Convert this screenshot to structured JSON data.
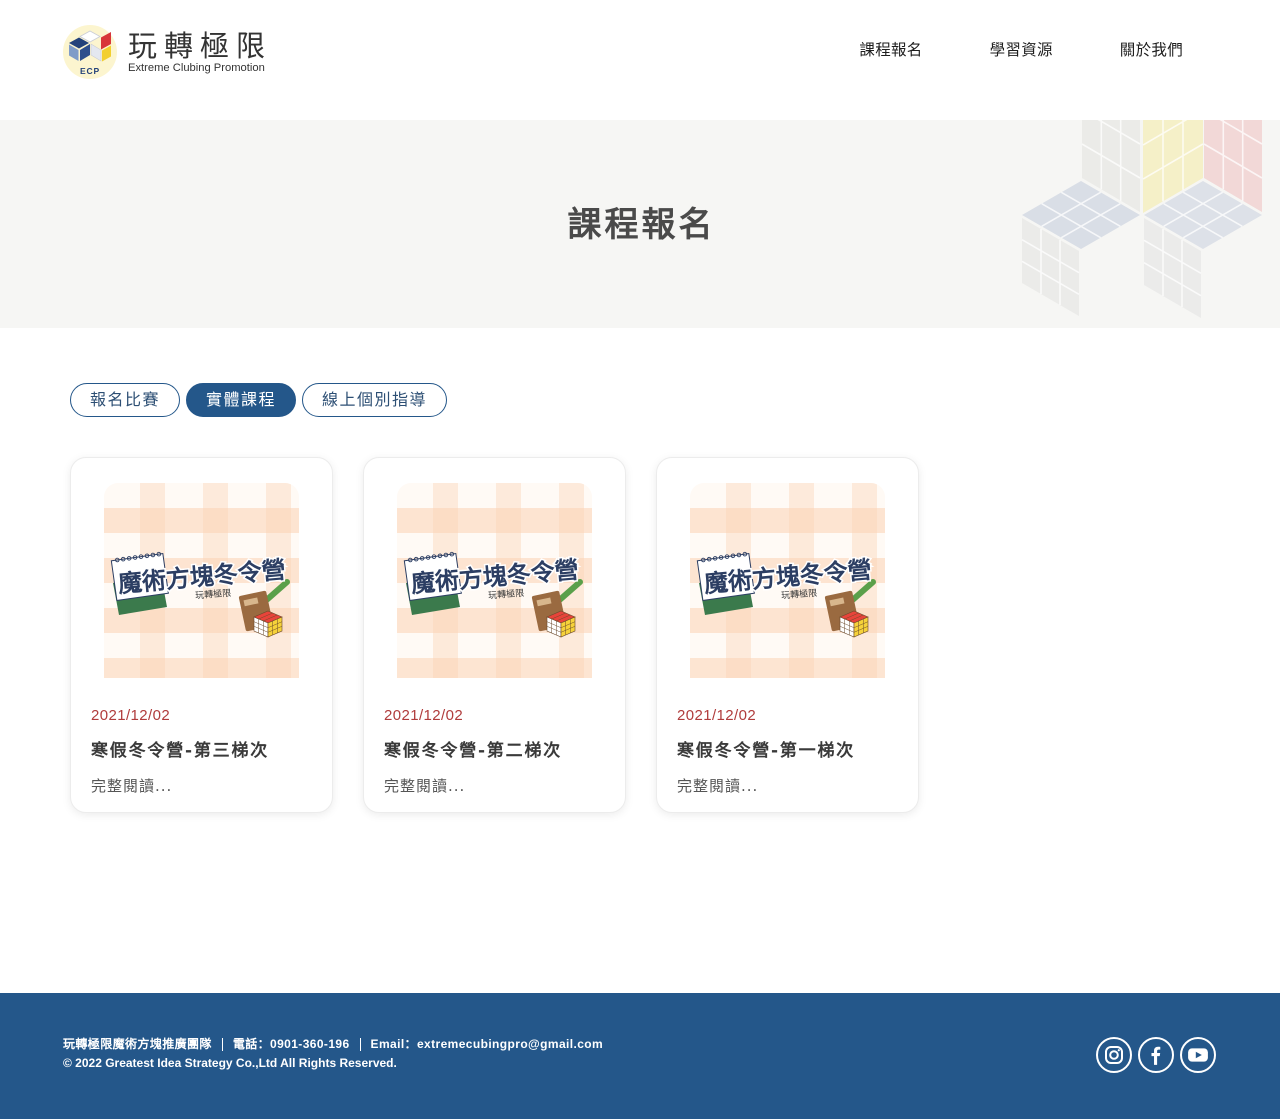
{
  "header": {
    "logo": {
      "badge": "ECP",
      "name": "玩轉極限",
      "tagline": "Extreme Clubing Promotion"
    },
    "nav": [
      {
        "label": "課程報名"
      },
      {
        "label": "學習資源"
      },
      {
        "label": "關於我們"
      }
    ]
  },
  "banner": {
    "title": "課程報名"
  },
  "main": {
    "tabs": [
      {
        "label": "報名比賽",
        "active": false
      },
      {
        "label": "實體課程",
        "active": true
      },
      {
        "label": "線上個別指導",
        "active": false
      }
    ],
    "cards": [
      {
        "image": {
          "title": "魔術方塊冬令營",
          "subtitle": "玩轉極限"
        },
        "date": "2021/12/02",
        "title": "寒假冬令營-第三梯次",
        "read_more": "完整閱讀..."
      },
      {
        "image": {
          "title": "魔術方塊冬令營",
          "subtitle": "玩轉極限"
        },
        "date": "2021/12/02",
        "title": "寒假冬令營-第二梯次",
        "read_more": "完整閱讀..."
      },
      {
        "image": {
          "title": "魔術方塊冬令營",
          "subtitle": "玩轉極限"
        },
        "date": "2021/12/02",
        "title": "寒假冬令營-第一梯次",
        "read_more": "完整閱讀..."
      }
    ]
  },
  "footer": {
    "team": "玩轉極限魔術方塊推廣團隊",
    "phone": "電話：0901-360-196",
    "email": "Email：extremecubingpro@gmail.com",
    "copyright": "© 2022 Greatest Idea Strategy Co.,Ltd All Rights Reserved.",
    "social": [
      {
        "icon": "instagram-icon"
      },
      {
        "icon": "facebook-icon"
      },
      {
        "icon": "youtube-icon"
      }
    ]
  },
  "colors": {
    "primary": "#24578a",
    "date": "#b03c3c",
    "banner_bg": "#f6f6f4"
  }
}
